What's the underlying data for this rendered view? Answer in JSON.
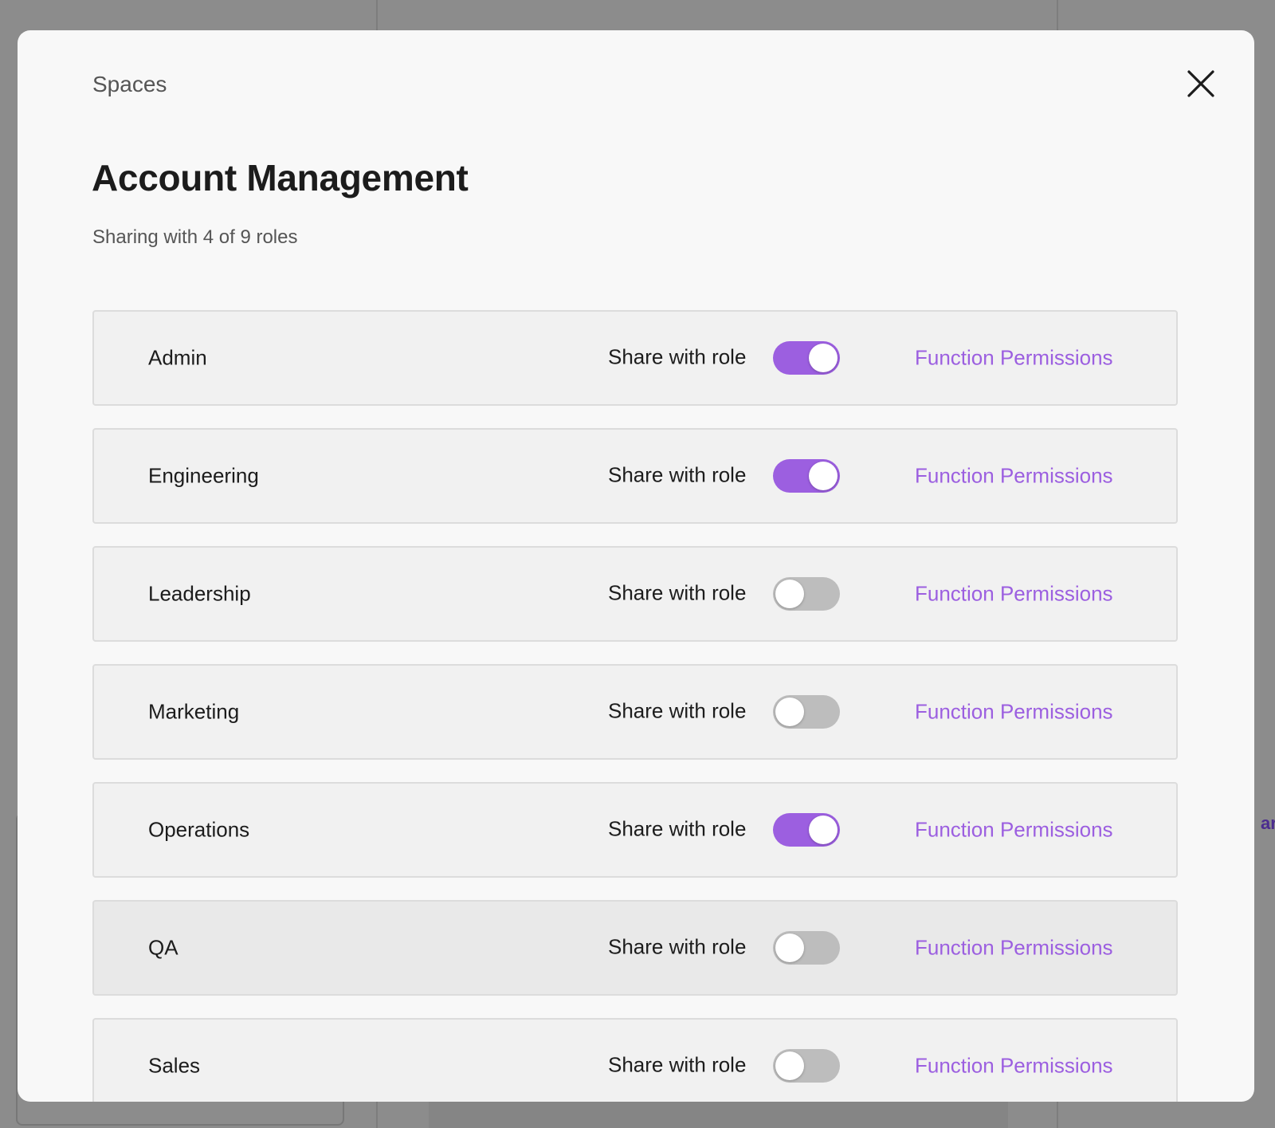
{
  "modal": {
    "breadcrumb": "Spaces",
    "title": "Account Management",
    "subtitle": "Sharing with 4 of 9 roles",
    "close_icon": "close-icon"
  },
  "background": {
    "partial_text": "ar"
  },
  "colors": {
    "accent": "#9c5fe0",
    "toggle_off": "#bdbdbd",
    "overlay": "#8c8c8c"
  },
  "roles": [
    {
      "name": "Admin",
      "share_label": "Share with role",
      "shared": true,
      "link": "Function Permissions"
    },
    {
      "name": "Engineering",
      "share_label": "Share with role",
      "shared": true,
      "link": "Function Permissions"
    },
    {
      "name": "Leadership",
      "share_label": "Share with role",
      "shared": false,
      "link": "Function Permissions"
    },
    {
      "name": "Marketing",
      "share_label": "Share with role",
      "shared": false,
      "link": "Function Permissions"
    },
    {
      "name": "Operations",
      "share_label": "Share with role",
      "shared": true,
      "link": "Function Permissions"
    },
    {
      "name": "QA",
      "share_label": "Share with role",
      "shared": false,
      "link": "Function Permissions",
      "hovered": true
    },
    {
      "name": "Sales",
      "share_label": "Share with role",
      "shared": false,
      "link": "Function Permissions"
    }
  ]
}
